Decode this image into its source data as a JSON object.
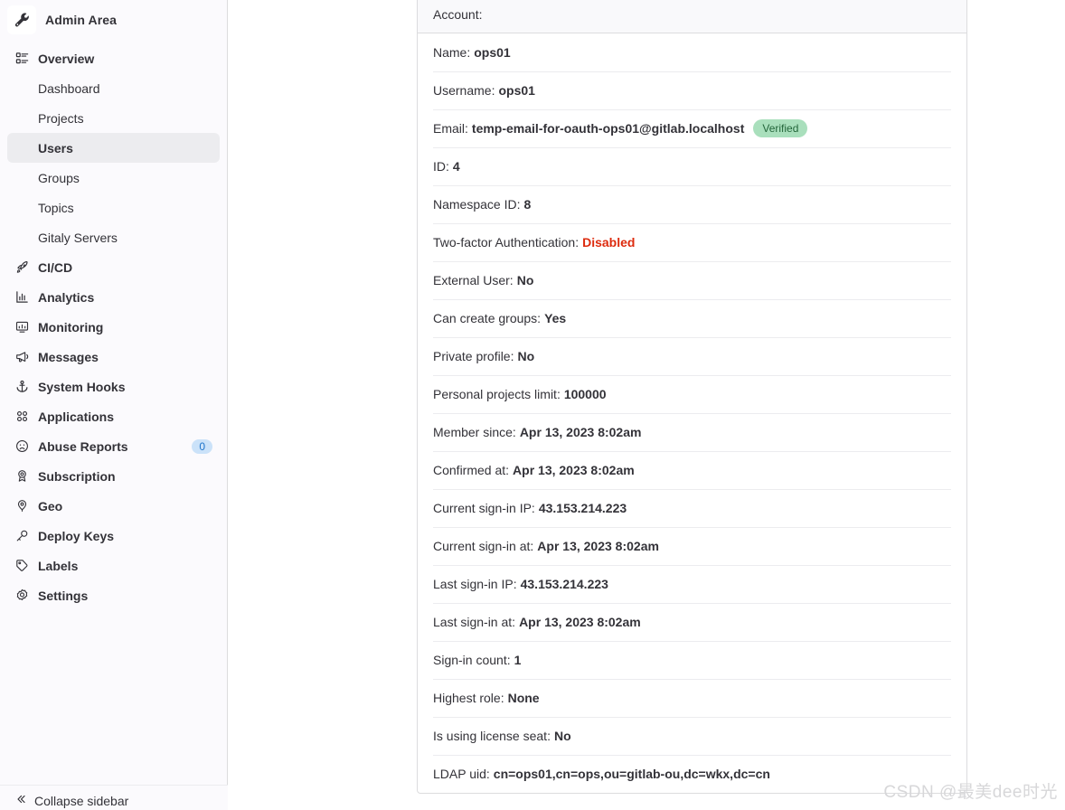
{
  "sidebar": {
    "brand": {
      "title": "Admin Area",
      "icon": "wrench-icon"
    },
    "items": [
      {
        "label": "Overview",
        "icon": "overview-icon",
        "type": "section"
      },
      {
        "label": "Dashboard",
        "icon": "",
        "type": "sub"
      },
      {
        "label": "Projects",
        "icon": "",
        "type": "sub"
      },
      {
        "label": "Users",
        "icon": "",
        "type": "sub",
        "active": true
      },
      {
        "label": "Groups",
        "icon": "",
        "type": "sub"
      },
      {
        "label": "Topics",
        "icon": "",
        "type": "sub"
      },
      {
        "label": "Gitaly Servers",
        "icon": "",
        "type": "sub"
      },
      {
        "label": "CI/CD",
        "icon": "rocket-icon",
        "type": "section"
      },
      {
        "label": "Analytics",
        "icon": "chart-icon",
        "type": "section"
      },
      {
        "label": "Monitoring",
        "icon": "monitor-icon",
        "type": "section"
      },
      {
        "label": "Messages",
        "icon": "megaphone-icon",
        "type": "section"
      },
      {
        "label": "System Hooks",
        "icon": "anchor-icon",
        "type": "section"
      },
      {
        "label": "Applications",
        "icon": "grid-dots-icon",
        "type": "section"
      },
      {
        "label": "Abuse Reports",
        "icon": "sad-face-icon",
        "type": "section",
        "badge": "0"
      },
      {
        "label": "Subscription",
        "icon": "license-icon",
        "type": "section"
      },
      {
        "label": "Geo",
        "icon": "location-pin-icon",
        "type": "section"
      },
      {
        "label": "Deploy Keys",
        "icon": "key-icon",
        "type": "section"
      },
      {
        "label": "Labels",
        "icon": "label-tag-icon",
        "type": "section"
      },
      {
        "label": "Settings",
        "icon": "gear-icon",
        "type": "section"
      }
    ],
    "collapse": {
      "label": "Collapse sidebar",
      "icon": "chevron-double-left-icon"
    }
  },
  "card": {
    "header": "Account:",
    "rows": [
      {
        "label": "Name:",
        "value": "ops01"
      },
      {
        "label": "Username:",
        "value": "ops01"
      },
      {
        "label": "Email:",
        "value": "temp-email-for-oauth-ops01@gitlab.localhost",
        "badge": "Verified"
      },
      {
        "label": "ID:",
        "value": "4"
      },
      {
        "label": "Namespace ID:",
        "value": "8"
      },
      {
        "label": "Two-factor Authentication:",
        "value": "Disabled",
        "danger": true
      },
      {
        "label": "External User:",
        "value": "No"
      },
      {
        "label": "Can create groups:",
        "value": "Yes"
      },
      {
        "label": "Private profile:",
        "value": "No"
      },
      {
        "label": "Personal projects limit:",
        "value": "100000"
      },
      {
        "label": "Member since:",
        "value": "Apr 13, 2023 8:02am"
      },
      {
        "label": "Confirmed at:",
        "value": "Apr 13, 2023 8:02am"
      },
      {
        "label": "Current sign-in IP:",
        "value": "43.153.214.223"
      },
      {
        "label": "Current sign-in at:",
        "value": "Apr 13, 2023 8:02am"
      },
      {
        "label": "Last sign-in IP:",
        "value": "43.153.214.223"
      },
      {
        "label": "Last sign-in at:",
        "value": "Apr 13, 2023 8:02am"
      },
      {
        "label": "Sign-in count:",
        "value": "1"
      },
      {
        "label": "Highest role:",
        "value": "None"
      },
      {
        "label": "Is using license seat:",
        "value": "No"
      },
      {
        "label": "LDAP uid:",
        "value": "cn=ops01,cn=ops,ou=gitlab-ou,dc=wkx,dc=cn"
      }
    ]
  },
  "watermark": "CSDN @最美dee时光",
  "colors": {
    "sidebar_bg": "#fbfafd",
    "active_bg": "#ececef",
    "text": "#333238",
    "danger": "#dd2b0e",
    "badge_green_bg": "#a9dfbc",
    "badge_green_text": "#24663b",
    "badge_blue_bg": "#cbe2f9",
    "badge_blue_text": "#1f75cb",
    "border": "#dcdcde"
  }
}
